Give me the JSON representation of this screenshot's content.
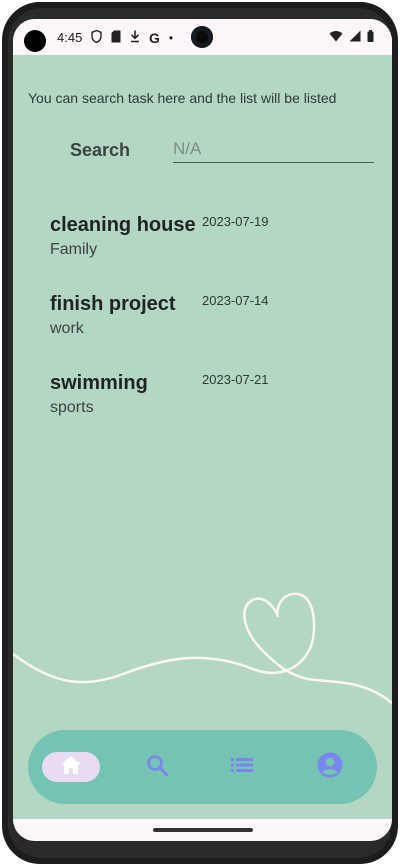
{
  "status_bar": {
    "time": "4:45",
    "icons": [
      "shield-icon",
      "sd-card-icon",
      "download-icon",
      "google-icon",
      "dot-icon"
    ],
    "right_icons": [
      "wifi-icon",
      "signal-icon",
      "battery-icon"
    ],
    "google_letter": "G",
    "dot": "•"
  },
  "hint_text": "You can search task here and the list will be listed",
  "search": {
    "label": "Search",
    "placeholder": "N/A",
    "value": ""
  },
  "tasks": [
    {
      "title": "cleaning house",
      "category": "Family",
      "date": "2023-07-19"
    },
    {
      "title": "finish project",
      "category": "work",
      "date": "2023-07-14"
    },
    {
      "title": "swimming",
      "category": "sports",
      "date": "2023-07-21"
    }
  ],
  "bottom_nav": {
    "items": [
      {
        "icon": "home-icon",
        "active": true
      },
      {
        "icon": "search-icon",
        "active": false
      },
      {
        "icon": "list-icon",
        "active": false
      },
      {
        "icon": "profile-icon",
        "active": false
      }
    ]
  },
  "colors": {
    "background": "#b3d7c2",
    "nav_background": "#75c4b3",
    "nav_active_pill": "#e7dcf4",
    "nav_icon": "#7a86ec",
    "home_icon": "#ffffff"
  }
}
